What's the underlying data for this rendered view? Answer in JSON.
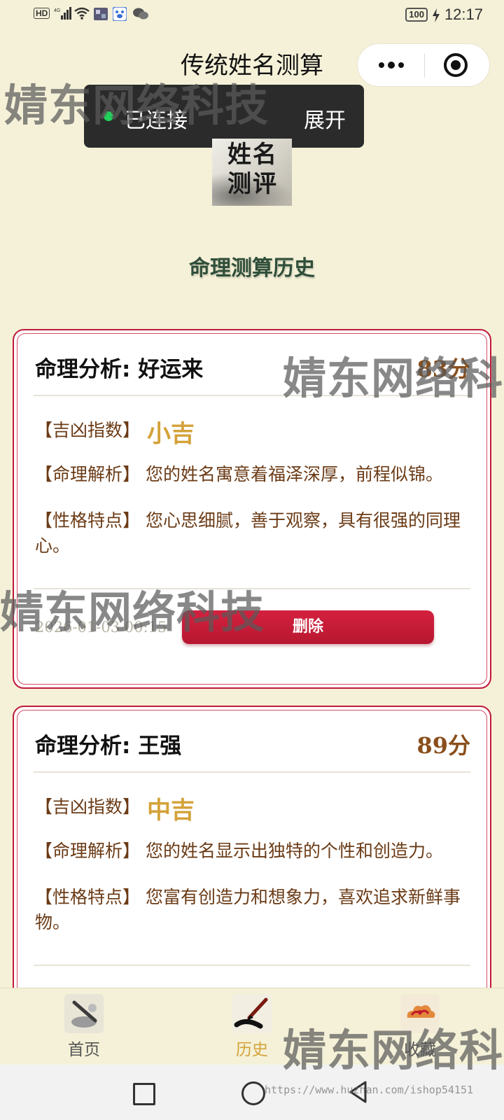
{
  "status_bar": {
    "network_badge": "HD",
    "signal_label": "4G",
    "battery": "100",
    "time": "12:17"
  },
  "header": {
    "title": "传统姓名测算",
    "more_icon": "more-dots-icon",
    "close_icon": "target-circle-icon"
  },
  "connection_popup": {
    "status": "已连接",
    "expand_label": "展开",
    "dot_color": "#21d05a"
  },
  "logo": {
    "text_line1": "姓名",
    "text_line2": "测评"
  },
  "section_heading": "命理测算历史",
  "records": [
    {
      "title": "命理分析: 好运来",
      "score": "83分",
      "luck_label": "【吉凶指数】",
      "luck_value": "小吉",
      "analysis_label": "【命理解析】",
      "analysis_text": "您的姓名寓意着福泽深厚，前程似锦。",
      "trait_label": "【性格特点】",
      "trait_text": "您心思细腻，善于观察，具有很强的同理心。",
      "date": "2026-01-03 00:15",
      "delete_label": "删除"
    },
    {
      "title": "命理分析: 王强",
      "score": "89分",
      "luck_label": "【吉凶指数】",
      "luck_value": "中吉",
      "analysis_label": "【命理解析】",
      "analysis_text": "您的姓名显示出独特的个性和创造力。",
      "trait_label": "【性格特点】",
      "trait_text": "您富有创造力和想象力，喜欢追求新鲜事物。"
    }
  ],
  "tabbar": {
    "items": [
      {
        "label": "首页",
        "icon": "brush-ink-icon",
        "active": false
      },
      {
        "label": "历史",
        "icon": "calligraphy-brush-icon",
        "active": true
      },
      {
        "label": "收藏",
        "icon": "auspicious-cloud-icon",
        "active": false
      }
    ]
  },
  "watermark": {
    "text": "婧东网络科技",
    "url": "https://www.huzhan.com/ishop54151"
  },
  "colors": {
    "background": "#f5f1d8",
    "accent_red": "#c0193a",
    "gold": "#d4a23a",
    "brown_text": "#6b3b16",
    "heading_green": "#2f4f3a"
  }
}
